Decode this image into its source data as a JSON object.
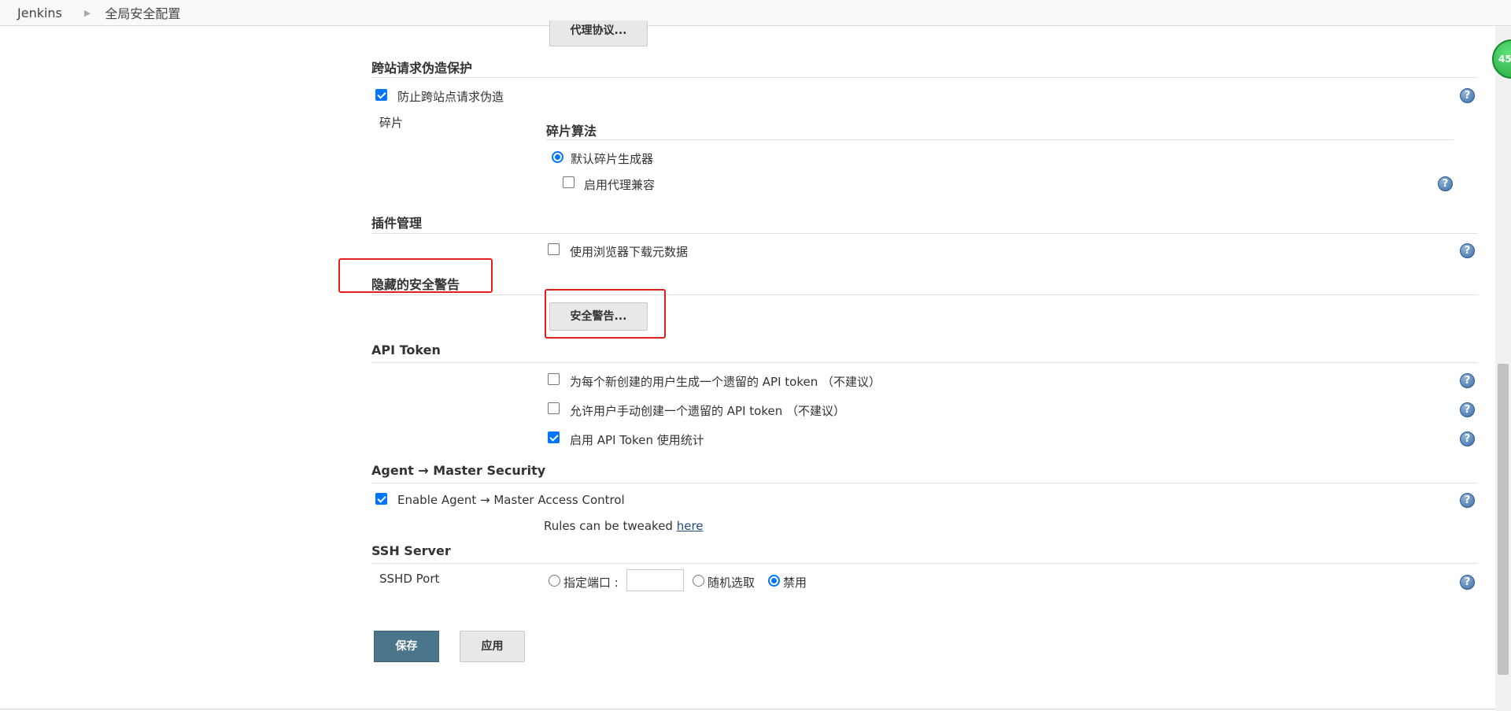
{
  "breadcrumb": {
    "home": "Jenkins",
    "current": "全局安全配置"
  },
  "agent_protocols_button": "代理协议...",
  "csrf": {
    "title": "跨站请求伪造保护",
    "prevent_label": "防止跨站点请求伪造",
    "prevent_checked": true,
    "crumb_label": "碎片",
    "crumb_algorithm_title": "碎片算法",
    "default_issuer_label": "默认碎片生成器",
    "proxy_compat_label": "启用代理兼容"
  },
  "plugin_manager": {
    "title": "插件管理",
    "browser_download_label": "使用浏览器下载元数据"
  },
  "hidden_warnings": {
    "title": "隐藏的安全警告",
    "button": "安全警告..."
  },
  "api_token": {
    "title": "API Token",
    "generate_legacy_label": "为每个新创建的用户生成一个遗留的 API token （不建议）",
    "allow_manual_legacy_label": "允许用户手动创建一个遗留的 API token （不建议）",
    "enable_usage_stats_label": "启用 API Token 使用统计"
  },
  "agent_master": {
    "title": "Agent → Master Security",
    "enable_label": "Enable Agent → Master Access Control",
    "rules_text": "Rules can be tweaked ",
    "rules_link": "here"
  },
  "ssh": {
    "title": "SSH Server",
    "port_label": "SSHD Port",
    "fixed_label": "指定端口 :",
    "fixed_value": "",
    "random_label": "随机选取",
    "disable_label": "禁用",
    "selected": "禁用"
  },
  "actions": {
    "save": "保存",
    "apply": "应用"
  },
  "help_icon_text": "?",
  "badge_text": "45",
  "colors": {
    "save_button": "#4b758b",
    "highlight": "#e02020",
    "accent": "#0075ff"
  }
}
